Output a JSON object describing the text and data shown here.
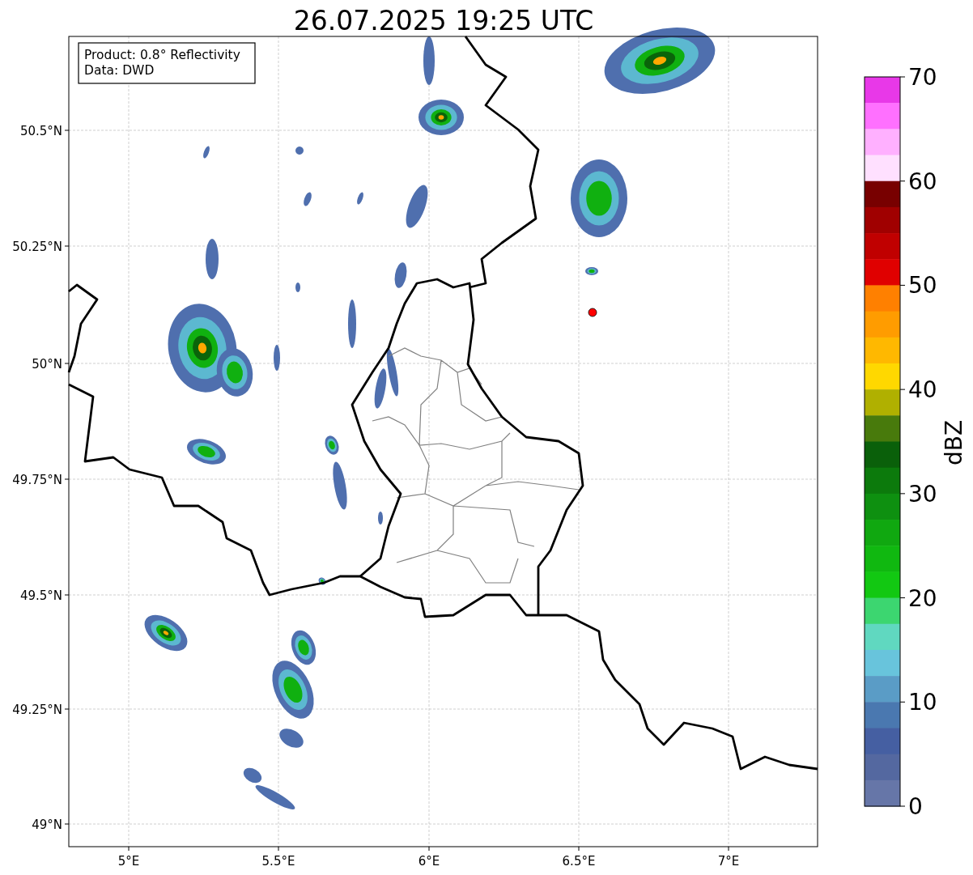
{
  "title": "26.07.2025 19:25 UTC",
  "info_box": [
    "Product: 0.8° Reflectivity",
    "Data: DWD"
  ],
  "x_ticks": [
    "5°E",
    "5.5°E",
    "6°E",
    "6.5°E",
    "7°E"
  ],
  "y_ticks": [
    "50.5°N",
    "50.25°N",
    "50°N",
    "49.75°N",
    "49.5°N",
    "49.25°N",
    "49°N"
  ],
  "colorbar": {
    "label": "dBZ",
    "ticks": [
      "70",
      "60",
      "50",
      "40",
      "30",
      "20",
      "10",
      "0"
    ],
    "levels": [
      {
        "color": "#e838e8"
      },
      {
        "color": "#ff70ff"
      },
      {
        "color": "#ffb0ff"
      },
      {
        "color": "#ffe0ff"
      },
      {
        "color": "#780000"
      },
      {
        "color": "#a00000"
      },
      {
        "color": "#c00000"
      },
      {
        "color": "#e00000"
      },
      {
        "color": "#ff8000"
      },
      {
        "color": "#ff9c00"
      },
      {
        "color": "#ffb800"
      },
      {
        "color": "#ffd800"
      },
      {
        "color": "#b0b000"
      },
      {
        "color": "#487a0c"
      },
      {
        "color": "#0a600a"
      },
      {
        "color": "#0c7a0c"
      },
      {
        "color": "#0e9010"
      },
      {
        "color": "#10a810"
      },
      {
        "color": "#10b810"
      },
      {
        "color": "#12c812"
      },
      {
        "color": "#3cd670"
      },
      {
        "color": "#60d8c0"
      },
      {
        "color": "#68c4dc"
      },
      {
        "color": "#5a9cc6"
      },
      {
        "color": "#4a78b0"
      },
      {
        "color": "#455fa2"
      },
      {
        "color": "#5468a0"
      },
      {
        "color": "#6676a8"
      }
    ]
  }
}
